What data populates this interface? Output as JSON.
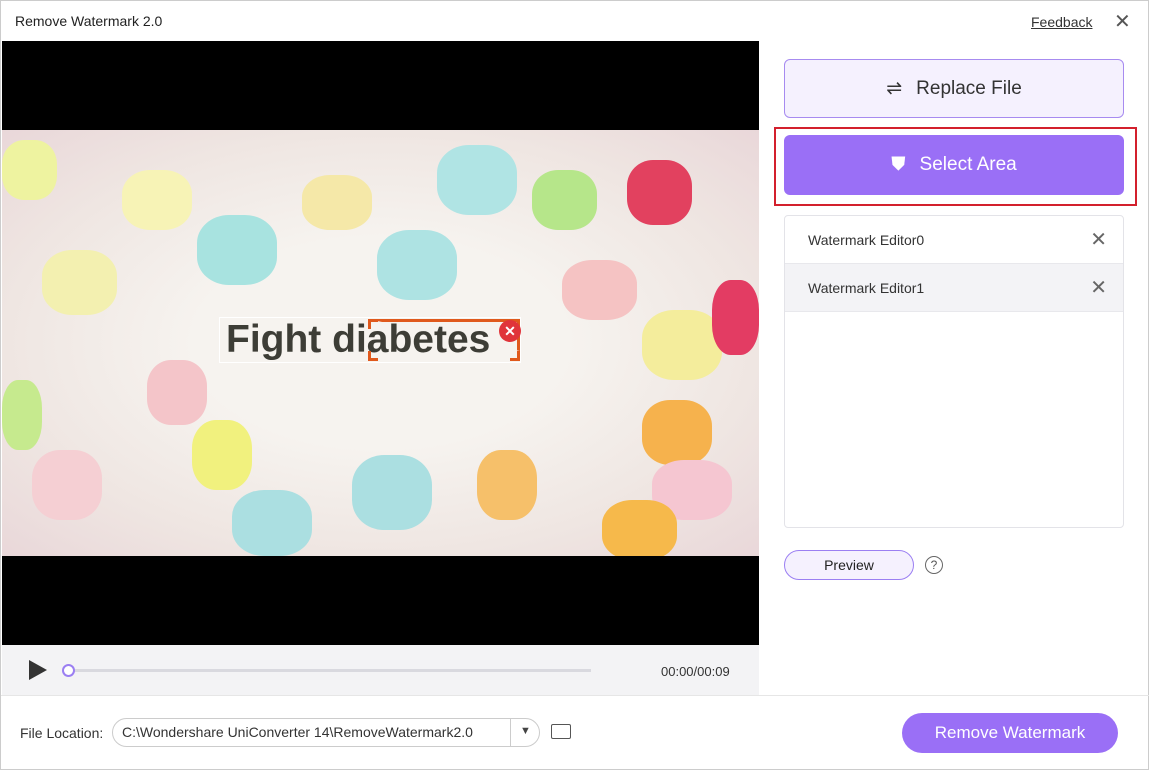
{
  "window": {
    "title": "Remove Watermark 2.0",
    "feedback": "Feedback"
  },
  "video": {
    "watermark_text": "Fight diabetes",
    "time": "00:00/00:09",
    "progress": 0
  },
  "side": {
    "replace_label": "Replace File",
    "select_label": "Select Area",
    "editors": [
      {
        "label": "Watermark Editor0"
      },
      {
        "label": "Watermark Editor1"
      }
    ],
    "preview_label": "Preview",
    "help": "?"
  },
  "footer": {
    "file_location_label": "File Location:",
    "file_location_value": "C:\\Wondershare UniConverter 14\\RemoveWatermark2.0",
    "remove_label": "Remove Watermark"
  },
  "colors": {
    "accent": "#9a6ff6",
    "highlight": "#d3202d"
  }
}
